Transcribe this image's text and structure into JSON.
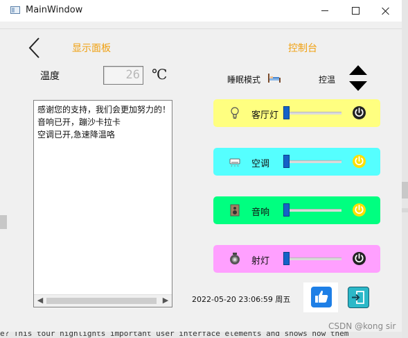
{
  "window": {
    "title": "MainWindow"
  },
  "header": {
    "display_panel_label": "显示面板",
    "console_label": "控制台"
  },
  "temperature": {
    "label": "温度",
    "value": "26",
    "unit": "℃"
  },
  "log": {
    "lines": [
      "感谢您的支持，我们会更加努力的！",
      "音响已开，蹦沙卡拉卡",
      "空调已开,急速降温咯"
    ]
  },
  "mode": {
    "sleep_label": "睡眠模式",
    "temp_ctrl_label": "控温"
  },
  "devices": [
    {
      "name": "客厅灯",
      "icon": "bulb-icon",
      "bg": "#ffff80",
      "power_color": "#222222",
      "on": false
    },
    {
      "name": "空调",
      "icon": "air-conditioner-icon",
      "bg": "#55ffff",
      "power_color": "#ffe000",
      "on": true
    },
    {
      "name": "音响",
      "icon": "speaker-icon",
      "bg": "#00ff80",
      "power_color": "#ffe000",
      "on": true
    },
    {
      "name": "射灯",
      "icon": "spotlight-icon",
      "bg": "#ffa0ff",
      "power_color": "#222222",
      "on": false
    }
  ],
  "status": {
    "datetime": "2022-05-20 23:06:59 周五"
  },
  "watermark": "CSDN @kong sir",
  "taskbar_text": "e? This tour highlights important user interface elements and shows how them"
}
